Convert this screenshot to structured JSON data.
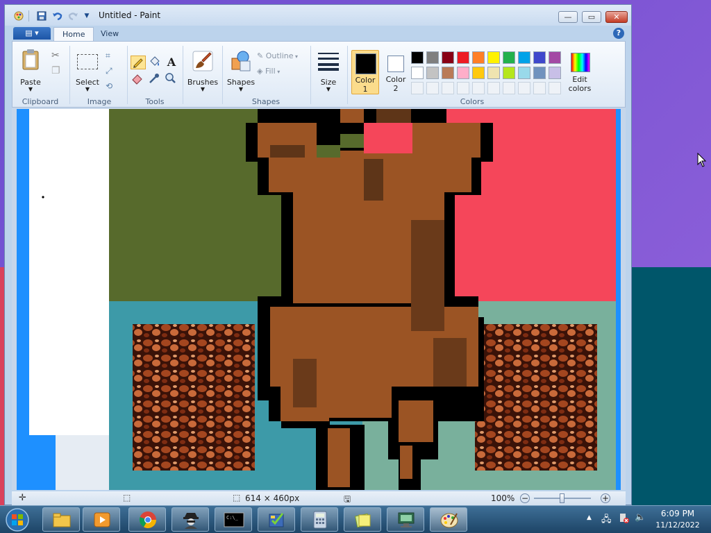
{
  "window": {
    "title": "Untitled - Paint",
    "minimize_glyph": "—",
    "maximize_glyph": "▭",
    "close_glyph": "✕"
  },
  "ribbon": {
    "tabs": [
      {
        "label": "Home",
        "active": true
      },
      {
        "label": "View",
        "active": false
      }
    ],
    "groups": {
      "clipboard": {
        "label": "Clipboard",
        "paste": "Paste"
      },
      "image": {
        "label": "Image",
        "select": "Select"
      },
      "tools": {
        "label": "Tools"
      },
      "brushes": {
        "label": "Brushes"
      },
      "shapes": {
        "label": "Shapes",
        "shapes_button": "Shapes",
        "outline": "Outline",
        "fill": "Fill"
      },
      "size": {
        "label": "Size"
      },
      "colors": {
        "label": "Colors",
        "color1": "Color\n1",
        "color1_line1": "Color",
        "color1_line2": "1",
        "color2_line1": "Color",
        "color2_line2": "2",
        "edit_line1": "Edit",
        "edit_line2": "colors",
        "color1_value": "#000000",
        "color2_value": "#ffffff",
        "palette_row1": [
          "#000000",
          "#7f7f7f",
          "#880015",
          "#ed1c24",
          "#ff7f27",
          "#fff200",
          "#22b14c",
          "#00a2e8",
          "#3f48cc",
          "#a349a4"
        ],
        "palette_row2": [
          "#ffffff",
          "#c3c3c3",
          "#b97a57",
          "#ffaec9",
          "#ffc90e",
          "#efe4b0",
          "#b5e61d",
          "#99d9ea",
          "#7092be",
          "#c8bfe7"
        ]
      }
    }
  },
  "canvas": {
    "quadrant_colors": {
      "top_left": "#576a2c",
      "top_right": "#f5465a",
      "bottom_left": "#3d9aa8",
      "bottom_right": "#79b09c"
    }
  },
  "statusbar": {
    "size_text": "614 × 460px",
    "zoom": "100%",
    "zoom_level": 1.0
  },
  "taskbar": {
    "time": "6:09 PM",
    "date": "11/12/2022"
  }
}
